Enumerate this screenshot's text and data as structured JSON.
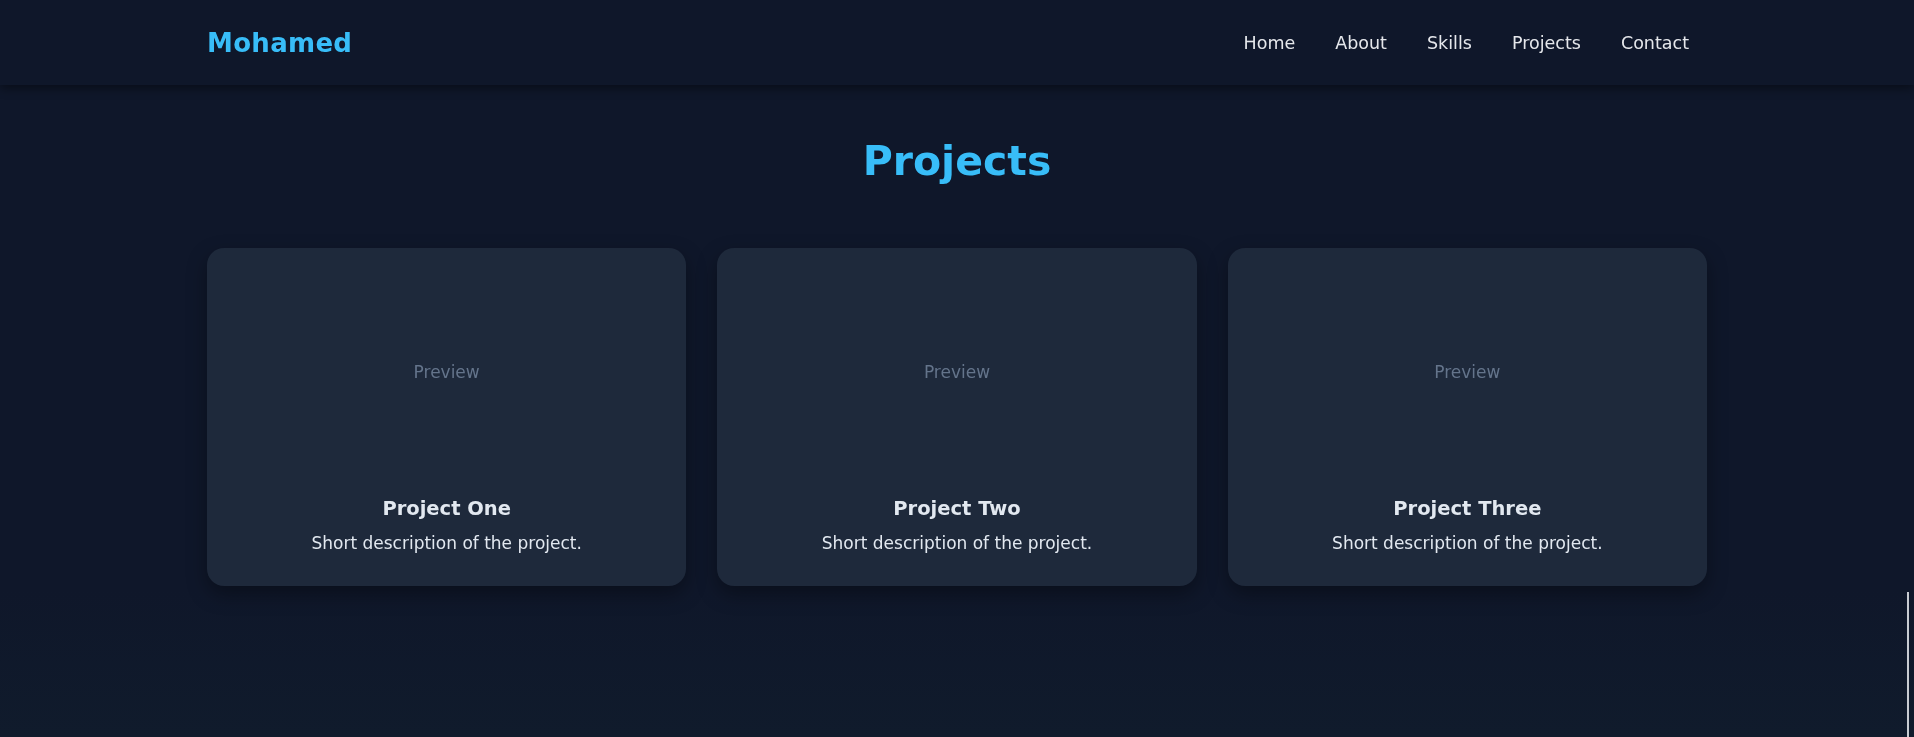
{
  "header": {
    "logo": "Mohamed",
    "nav": [
      "Home",
      "About",
      "Skills",
      "Projects",
      "Contact"
    ]
  },
  "projects_section": {
    "title": "Projects",
    "cards": [
      {
        "preview": "Preview",
        "title": "Project One",
        "description": "Short description of the project."
      },
      {
        "preview": "Preview",
        "title": "Project Two",
        "description": "Short description of the project."
      },
      {
        "preview": "Preview",
        "title": "Project Three",
        "description": "Short description of the project."
      }
    ]
  }
}
